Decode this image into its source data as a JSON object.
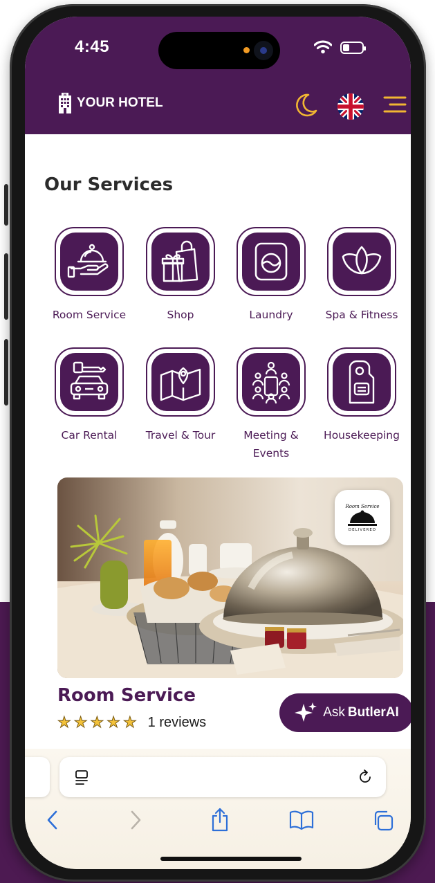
{
  "status_bar": {
    "time": "4:45"
  },
  "header": {
    "brand_name": "YOUR HOTEL",
    "icons": [
      "hotel-icon",
      "moon-icon",
      "uk-flag-icon",
      "menu-icon"
    ]
  },
  "section_title": "Our Services",
  "services": [
    {
      "label": "Room Service",
      "icon": "cloche-icon"
    },
    {
      "label": "Shop",
      "icon": "shopping-bag-icon"
    },
    {
      "label": "Laundry",
      "icon": "washing-machine-icon"
    },
    {
      "label": "Spa & Fitness",
      "icon": "lotus-icon"
    },
    {
      "label": "Car Rental",
      "icon": "car-key-icon"
    },
    {
      "label": "Travel & Tour",
      "icon": "map-icon"
    },
    {
      "label": "Meeting & Events",
      "icon": "meeting-icon"
    },
    {
      "label": "Housekeeping",
      "icon": "door-hanger-icon"
    }
  ],
  "featured": {
    "badge_line1": "Room Service",
    "badge_line2": "DELIVERED",
    "title": "Room Service",
    "rating": 5,
    "reviews": "1 reviews",
    "ask_prefix": "Ask",
    "ask_name": "ButlerAI"
  },
  "colors": {
    "brand": "#4b1a55",
    "accent": "#f2b632",
    "star": "#f3c23a"
  },
  "browser_icons": [
    "reader-icon",
    "reload-icon",
    "back-icon",
    "forward-icon",
    "share-icon",
    "bookmarks-icon",
    "tabs-icon"
  ]
}
